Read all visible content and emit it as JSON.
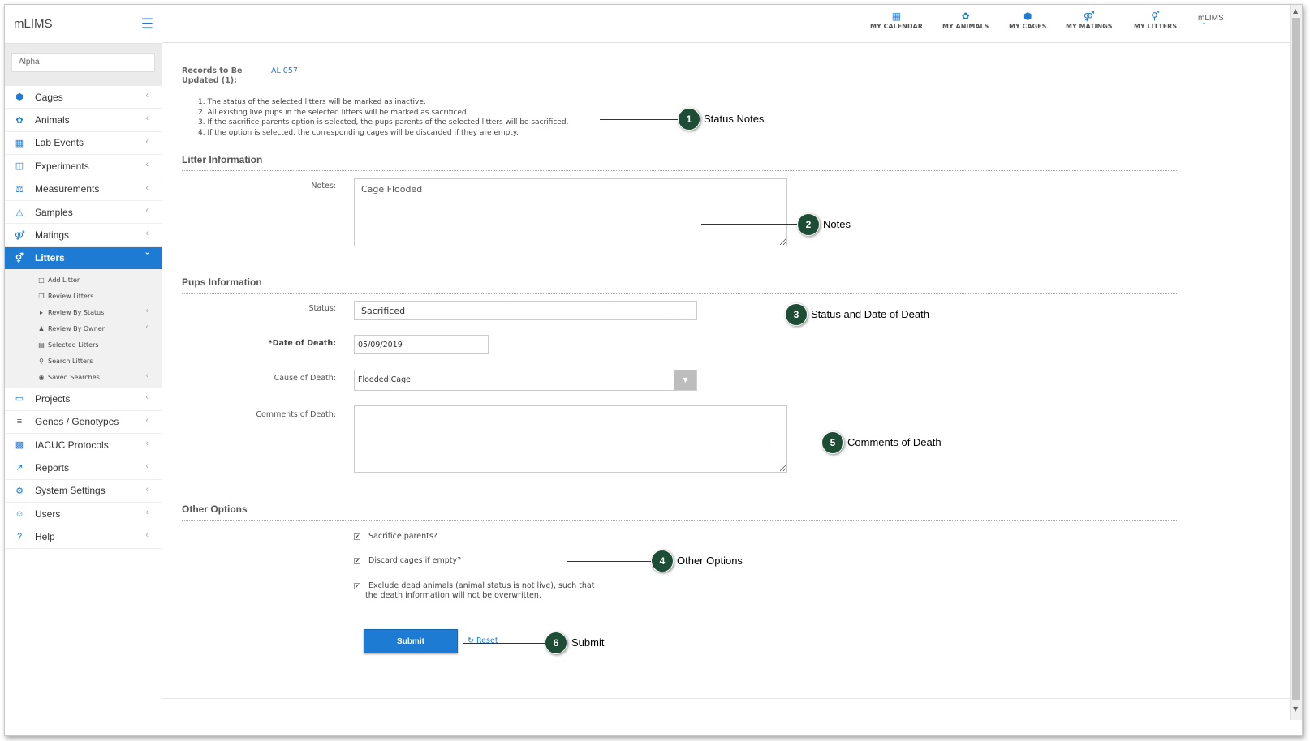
{
  "app": {
    "brand": "mLIMS",
    "search_value": "Alpha"
  },
  "sidebar": {
    "items": [
      {
        "label": "Cages",
        "icon": "cube-icon"
      },
      {
        "label": "Animals",
        "icon": "paw-icon"
      },
      {
        "label": "Lab Events",
        "icon": "calendar-icon"
      },
      {
        "label": "Experiments",
        "icon": "experiment-icon"
      },
      {
        "label": "Measurements",
        "icon": "balance-icon"
      },
      {
        "label": "Samples",
        "icon": "flask-icon"
      },
      {
        "label": "Matings",
        "icon": "mating-icon"
      },
      {
        "label": "Litters",
        "icon": "litter-icon"
      }
    ],
    "litters_sub": [
      {
        "label": "Add Litter",
        "icon": "file-icon"
      },
      {
        "label": "Review Litters",
        "icon": "copy-icon"
      },
      {
        "label": "Review By Status",
        "icon": "caret-right-icon"
      },
      {
        "label": "Review By Owner",
        "icon": "user-icon"
      },
      {
        "label": "Selected Litters",
        "icon": "cart-icon"
      },
      {
        "label": "Search Litters",
        "icon": "search-icon"
      },
      {
        "label": "Saved Searches",
        "icon": "dot-circle-icon"
      }
    ],
    "items_after": [
      {
        "label": "Projects",
        "icon": "folder-icon"
      },
      {
        "label": "Genes / Genotypes",
        "icon": "list-icon"
      },
      {
        "label": "IACUC Protocols",
        "icon": "book-icon"
      },
      {
        "label": "Reports",
        "icon": "chart-icon"
      },
      {
        "label": "System Settings",
        "icon": "gear-icon"
      },
      {
        "label": "Users",
        "icon": "users-icon"
      },
      {
        "label": "Help",
        "icon": "question-icon"
      }
    ]
  },
  "header": {
    "links": [
      "MY CALENDAR",
      "MY ANIMALS",
      "MY CAGES",
      "MY MATINGS",
      "MY LITTERS"
    ],
    "user": "mLIMS"
  },
  "form": {
    "records_label": "Records to Be Updated (1):",
    "records_value": "AL 057",
    "notes": [
      "1. The status of the selected litters will be marked as inactive.",
      "2. All existing live pups in the selected litters will be marked as sacrificed.",
      "3. If the sacrifice parents option is selected, the pups parents of the selected litters will be sacrificed.",
      "4. If the option is selected, the corresponding cages will be discarded if they are empty."
    ],
    "litter_section": "Litter Information",
    "notes_label": "Notes:",
    "notes_value": "Cage Flooded",
    "pups_section": "Pups Information",
    "status_label": "Status:",
    "status_value": "Sacrificed",
    "dod_label": "*Date of Death:",
    "dod_value": "05/09/2019",
    "cause_label": "Cause of Death:",
    "cause_value": "Flooded Cage",
    "comments_label": "Comments of Death:",
    "comments_value": "",
    "other_section": "Other Options",
    "opt1": "Sacrifice parents?",
    "opt2": "Discard cages if empty?",
    "opt3": "Exclude dead animals (animal status is not live), such that",
    "opt3b": "the death information will not be overwritten.",
    "submit": "Submit",
    "reset": "Reset"
  },
  "callouts": [
    {
      "num": "1",
      "text": "Status Notes"
    },
    {
      "num": "2",
      "text": "Notes"
    },
    {
      "num": "3",
      "text": "Status and Date of Death"
    },
    {
      "num": "5",
      "text": "Comments of Death"
    },
    {
      "num": "4",
      "text": "Other Options"
    },
    {
      "num": "6",
      "text": "Submit"
    }
  ]
}
